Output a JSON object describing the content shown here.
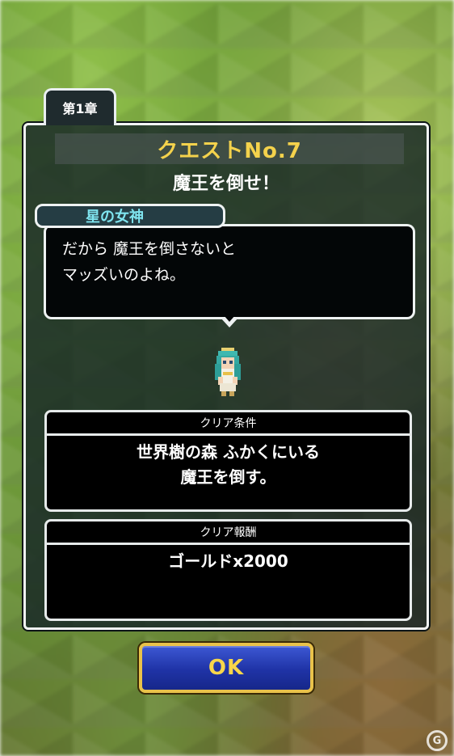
{
  "chapter": {
    "label": "第1章"
  },
  "quest": {
    "number_title": "クエストNo.7",
    "subtitle": "魔王を倒せ！"
  },
  "dialogue": {
    "speaker": "星の女神",
    "lines": [
      "だから 魔王を倒さないと",
      "マッズいのよね。"
    ]
  },
  "clear_condition": {
    "header": "クリア条件",
    "lines": [
      "世界樹の森 ふかくにいる",
      "魔王を倒す。"
    ]
  },
  "clear_reward": {
    "header": "クリア報酬",
    "lines": [
      "ゴールドx2000"
    ]
  },
  "ok_button": {
    "label": "OK"
  },
  "colors": {
    "quest_title": "#f4d24c",
    "speaker_name": "#7fe4ef",
    "ok_label": "#f7d64a",
    "ok_fill": "#1f33a6",
    "ok_border": "#e9c24a"
  },
  "icons": {
    "sprite": "goddess-sprite",
    "logo": "g-logo-icon"
  }
}
